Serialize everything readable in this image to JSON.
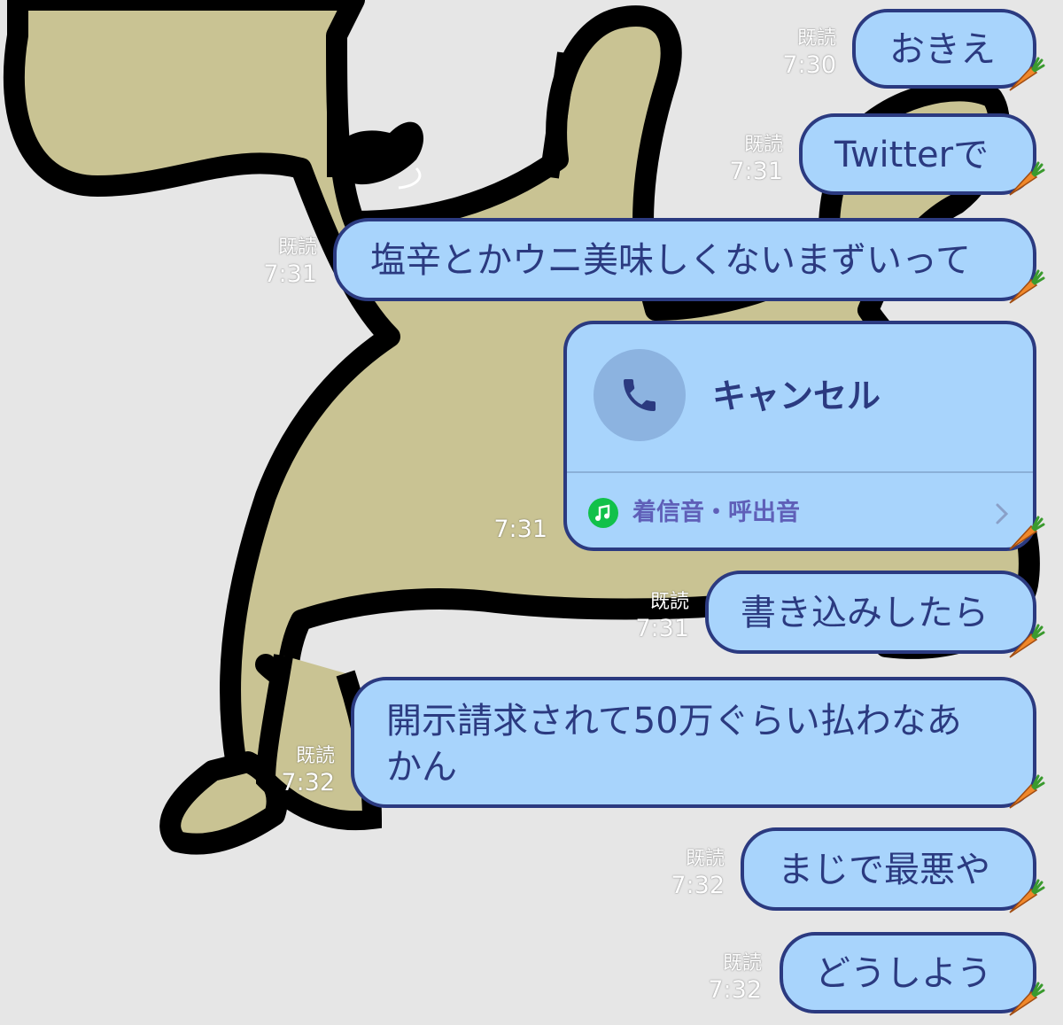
{
  "colors": {
    "bubble": "#a8d4fc",
    "bubble_border": "#2b3a80",
    "text": "#2b3a80",
    "link": "#5f5fb8",
    "music_icon": "#11c14a",
    "background": "#e6e6e6"
  },
  "messages": [
    {
      "text": "おきえ",
      "read": "既読",
      "time": "7:30"
    },
    {
      "text": "Twitterで",
      "read": "既読",
      "time": "7:31"
    },
    {
      "text": "塩辛とかウニ美味しくないまずいって",
      "read": "既読",
      "time": "7:31"
    },
    {
      "text": "書き込みしたら",
      "read": "既読",
      "time": "7:31"
    },
    {
      "lines": [
        "開示請求されて50万ぐらい払わなあ",
        "かん"
      ],
      "read": "既読",
      "time": "7:32"
    },
    {
      "text": "まじで最悪や",
      "read": "既読",
      "time": "7:32"
    },
    {
      "text": "どうしよう",
      "read": "既読",
      "time": "7:32"
    }
  ],
  "call": {
    "status": "キャンセル",
    "ringtone_label": "着信音・呼出音",
    "time": "7:31",
    "icon": "phone-icon"
  },
  "icons": {
    "sticker_decoration": "carrot-icon",
    "background": "dog-illustration"
  }
}
